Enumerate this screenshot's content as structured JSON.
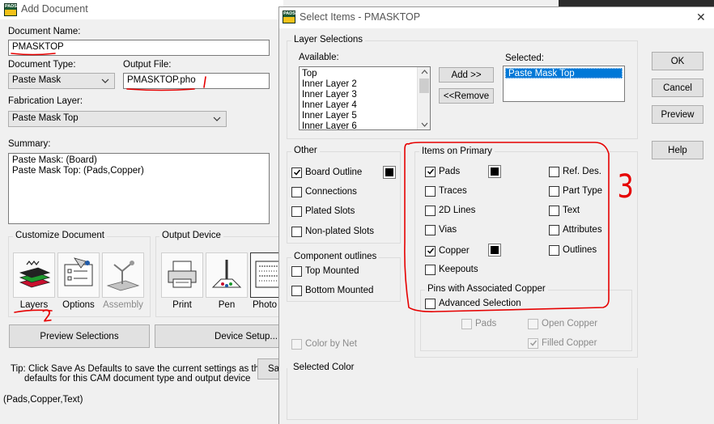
{
  "add_document": {
    "title": "Add Document",
    "app_icon_text": "PADS",
    "document_name": {
      "label": "Document Name:",
      "value": "PMASKTOP"
    },
    "document_type": {
      "label": "Document Type:",
      "value": "Paste Mask"
    },
    "output_file": {
      "label": "Output File:",
      "value": "PMASKTOP.pho"
    },
    "fabrication_layer": {
      "label": "Fabrication Layer:",
      "value": "Paste Mask Top"
    },
    "summary": {
      "label": "Summary:",
      "lines": [
        "Paste Mask: (Board)",
        "Paste Mask Top: (Pads,Copper)"
      ]
    },
    "customize": {
      "label": "Customize Document",
      "items": [
        {
          "name": "Layers",
          "icon": "layers-icon"
        },
        {
          "name": "Options",
          "icon": "options-icon"
        },
        {
          "name": "Assembly",
          "icon": "assembly-icon"
        }
      ]
    },
    "output_device": {
      "label": "Output Device",
      "items": [
        {
          "name": "Print",
          "icon": "printer-icon"
        },
        {
          "name": "Pen",
          "icon": "pen-plotter-icon"
        },
        {
          "name": "Photo",
          "icon": "photo-plotter-icon"
        }
      ]
    },
    "preview_button": "Preview Selections",
    "device_setup_button": "Device Setup...",
    "save_button": "Sav",
    "tip_line1": "Tip: Click Save As Defaults to save the current settings as the",
    "tip_line2": "defaults for this CAM document type and output device",
    "status_text": "(Pads,Copper,Text)"
  },
  "select_items": {
    "title": "Select Items - PMASKTOP",
    "app_icon_text": "PADS",
    "close_glyph": "✕",
    "layer_selections": {
      "label": "Layer Selections",
      "available_label": "Available:",
      "available": [
        "Top",
        "Inner Layer 2",
        "Inner Layer 3",
        "Inner Layer 4",
        "Inner Layer 5",
        "Inner Layer 6"
      ],
      "add_button": "Add >>",
      "remove_button": "<<Remove",
      "selected_label": "Selected:",
      "selected": [
        "Paste Mask Top"
      ]
    },
    "other": {
      "label": "Other",
      "items": [
        {
          "label": "Board Outline",
          "checked": true
        },
        {
          "label": "Connections",
          "checked": false
        },
        {
          "label": "Plated Slots",
          "checked": false
        },
        {
          "label": "Non-plated Slots",
          "checked": false
        }
      ]
    },
    "component_outlines": {
      "label": "Component outlines",
      "items": [
        {
          "label": "Top Mounted",
          "checked": false
        },
        {
          "label": "Bottom Mounted",
          "checked": false
        }
      ]
    },
    "color_by_net": "Color by Net",
    "items_on_primary": {
      "label": "Items on Primary",
      "left": [
        {
          "label": "Pads",
          "checked": true
        },
        {
          "label": "Traces",
          "checked": false
        },
        {
          "label": "2D Lines",
          "checked": false
        },
        {
          "label": "Vias",
          "checked": false
        },
        {
          "label": "Copper",
          "checked": true
        },
        {
          "label": "Keepouts",
          "checked": false
        }
      ],
      "right": [
        {
          "label": "Ref. Des.",
          "checked": false
        },
        {
          "label": "Part Type",
          "checked": false
        },
        {
          "label": "Text",
          "checked": false
        },
        {
          "label": "Attributes",
          "checked": false
        },
        {
          "label": "Outlines",
          "checked": false
        }
      ]
    },
    "pins_group": {
      "label": "Pins with Associated Copper",
      "advanced": "Advanced Selection",
      "pads": "Pads",
      "open_copper": "Open Copper",
      "filled_copper": "Filled Copper"
    },
    "selected_color_label": "Selected Color",
    "buttons": {
      "ok": "OK",
      "cancel": "Cancel",
      "preview": "Preview",
      "help": "Help"
    }
  },
  "annotations": {
    "mark_2": "2",
    "mark_3": "3"
  },
  "colors": {
    "swatch": "#000000",
    "selection": "#0078d7",
    "annotation": "#e60000"
  }
}
